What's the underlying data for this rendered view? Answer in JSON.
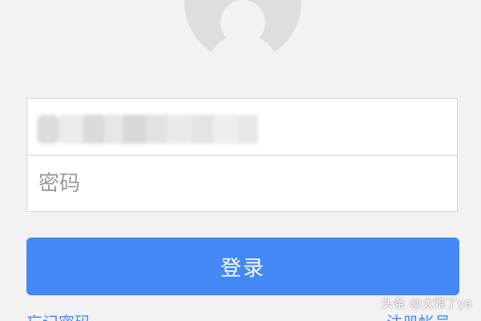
{
  "form": {
    "password_placeholder": "密码",
    "login_label": "登录"
  },
  "links": {
    "left": "忘记密码",
    "right": "注册帐号"
  },
  "watermark": "头条 @太难了ya",
  "colors": {
    "background": "#f2f2f2",
    "accent": "#4388f4",
    "avatar": "#dedede"
  },
  "icons": {
    "avatar": "user-placeholder-icon"
  }
}
